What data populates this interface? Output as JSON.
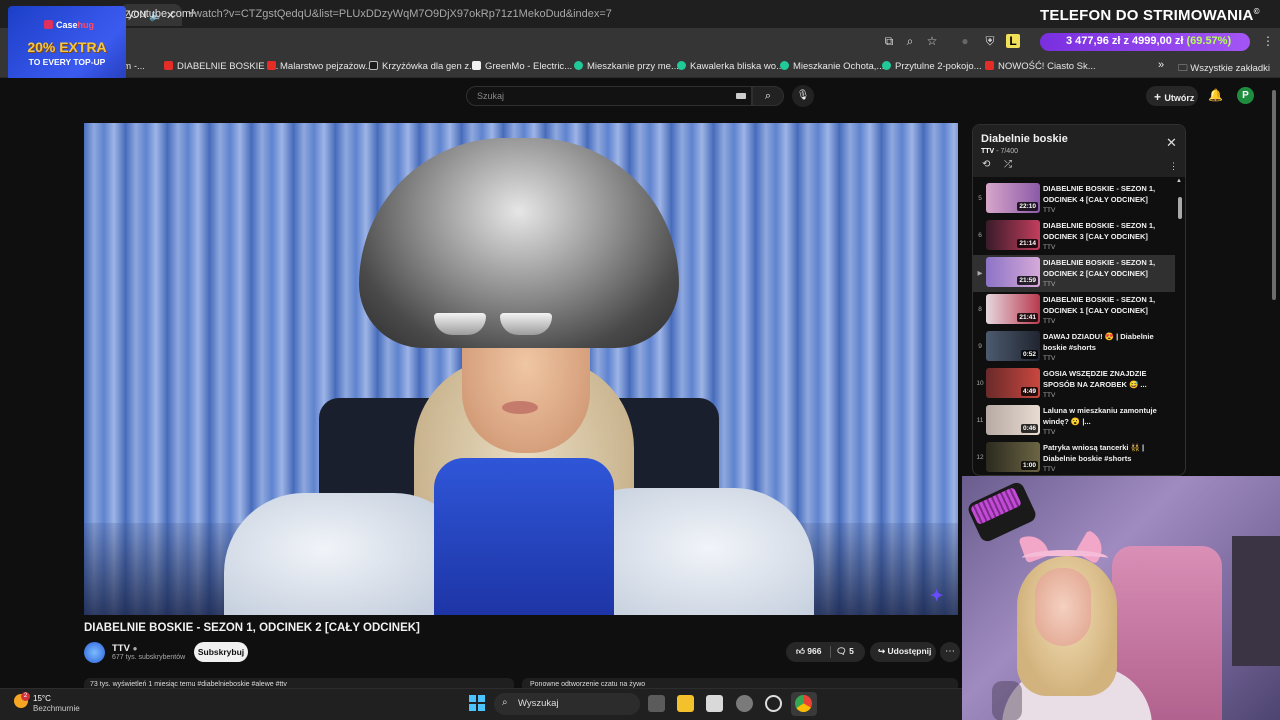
{
  "browser": {
    "active_tab_title": "ZON",
    "new_tab": "+",
    "url_host": "youtube.com",
    "url_path": "/watch?v=CTZgstQedqU&list=PLUxDDzyWqM7O9DjX97okRp71z1MekoDud&index=7",
    "bookmarks": [
      {
        "label": "um -...",
        "icon": "youtube-icon"
      },
      {
        "label": "DIABELNIE BOSKIE -...",
        "icon": "youtube-icon"
      },
      {
        "label": "Malarstwo pejzażow...",
        "icon": "youtube-icon"
      },
      {
        "label": "Krzyżówka dla gen z...",
        "icon": "page-icon"
      },
      {
        "label": "GreenMo - Electric...",
        "icon": "page-icon"
      },
      {
        "label": "Mieszkanie przy me...",
        "icon": "otodom-icon"
      },
      {
        "label": "Kawalerka bliska wo...",
        "icon": "otodom-icon"
      },
      {
        "label": "Mieszkanie Ochota,...",
        "icon": "otodom-icon"
      },
      {
        "label": "Przytulne 2-pokojo...",
        "icon": "otodom-icon"
      },
      {
        "label": "NOWOŚĆ! Ciasto Sk...",
        "icon": "youtube-icon"
      }
    ],
    "all_bookmarks": "Wszystkie zakładki",
    "overflow": "»"
  },
  "stream_overlay": {
    "title": "TELEFON DO STRIMOWANIA",
    "goal_text": "3 477,96 zł z 4999,00 zł",
    "goal_percent": "(69.57%)",
    "goal_fraction": 0.6957
  },
  "ad": {
    "brand_a": "Case",
    "brand_b": "hug",
    "headline": "20% EXTRA",
    "subline": "TO EVERY TOP-UP"
  },
  "youtube": {
    "search_placeholder": "Szukaj",
    "create_label": "Utwórz",
    "avatar_letter": "P",
    "video_title": "DIABELNIE BOSKIE - SEZON 1, ODCINEK 2 [CAŁY ODCINEK]",
    "channel_name": "TTV",
    "channel_subs": "677 tys. subskrybentów",
    "subscribe_label": "Subskrybuj",
    "likes": "966",
    "dislikes": "5",
    "share_label": "Udostępnij",
    "more_label": "⋯",
    "desc_preview": "73 tys. wyświetleń  1 miesiąc temu  #diabelnieboskie #alewe #ttv",
    "comments_preview": "Ponowne odtworzenie czatu na żywo"
  },
  "playlist": {
    "title": "Diabelnie boskie",
    "channel": "TTV",
    "position": "- 7/400",
    "items": [
      {
        "num": "5",
        "title": "DIABELNIE BOSKIE - SEZON 1, ODCINEK 4 [CAŁY ODCINEK]",
        "channel": "TTV",
        "duration": "22:10",
        "selected": false
      },
      {
        "num": "6",
        "title": "DIABELNIE BOSKIE - SEZON 1, ODCINEK 3 [CAŁY ODCINEK]",
        "channel": "TTV",
        "duration": "21:14",
        "selected": false
      },
      {
        "num": "▶",
        "title": "DIABELNIE BOSKIE - SEZON 1, ODCINEK 2 [CAŁY ODCINEK]",
        "channel": "TTV",
        "duration": "21:59",
        "selected": true
      },
      {
        "num": "8",
        "title": "DIABELNIE BOSKIE - SEZON 1, ODCINEK 1 [CAŁY ODCINEK]",
        "channel": "TTV",
        "duration": "21:41",
        "selected": false
      },
      {
        "num": "9",
        "title": "DAWAJ DZIADU! 😍 | Diabelnie boskie #shorts",
        "channel": "TTV",
        "duration": "0:52",
        "selected": false
      },
      {
        "num": "10",
        "title": "GOSIA WSZĘDZIE ZNAJDZIE SPOSÓB NA ZAROBEK 😅 ...",
        "channel": "TTV",
        "duration": "4:49",
        "selected": false
      },
      {
        "num": "11",
        "title": "Laluna w mieszkaniu zamontuje windę? 😮 |...",
        "channel": "TTV",
        "duration": "0:46",
        "selected": false
      },
      {
        "num": "12",
        "title": "Patryka wniosą tancerki 👯 | Diabelnie boskie #shorts",
        "channel": "TTV",
        "duration": "1:00",
        "selected": false
      }
    ]
  },
  "taskbar": {
    "temperature": "15°C",
    "weather": "Bezchmurnie",
    "weather_badge": "2",
    "search_label": "Wyszukaj"
  },
  "colors": {
    "accent_red": "#e52d27",
    "goal_purple": "#8b3fe8",
    "goal_green": "#b4ff5a",
    "ad_blue": "#2f4fe0",
    "ad_gold": "#f3c646"
  }
}
